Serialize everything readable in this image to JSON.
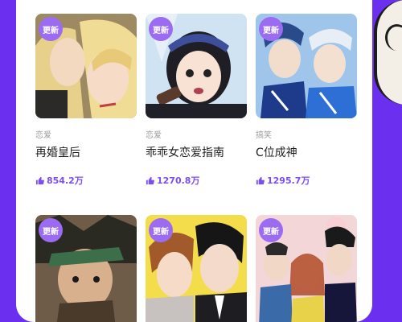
{
  "colors": {
    "accent": "#6b2ff0",
    "badge": "#9b6cf2",
    "likes": "#7b4ef0"
  },
  "comics": [
    {
      "badge": "更新",
      "genre": "恋爱",
      "title": "再婚皇后",
      "likes": "854.2万",
      "icon": "thumbs-up-icon"
    },
    {
      "badge": "更新",
      "genre": "恋爱",
      "title": "乖乖女恋爱指南",
      "likes": "1270.8万",
      "icon": "thumbs-up-icon"
    },
    {
      "badge": "更新",
      "genre": "搞笑",
      "title": "C位成神",
      "likes": "1295.7万",
      "icon": "thumbs-up-icon"
    },
    {
      "badge": "更新"
    },
    {
      "badge": "更新"
    },
    {
      "badge": "更新"
    }
  ]
}
